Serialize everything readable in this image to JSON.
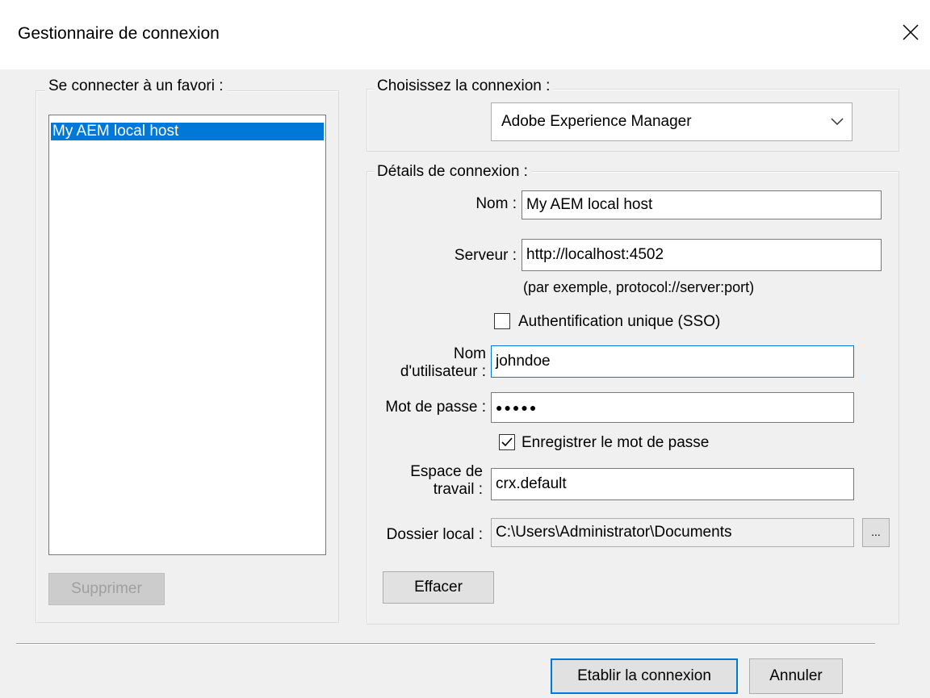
{
  "window": {
    "title": "Gestionnaire de connexion"
  },
  "favorites": {
    "group_label": "Se connecter à un favori :",
    "items": [
      "My AEM local host"
    ],
    "delete_button": "Supprimer"
  },
  "connection": {
    "group_label": "Choisissez la connexion :",
    "selected": "Adobe Experience Manager"
  },
  "details": {
    "group_label": "Détails de connexion :",
    "name_label": "Nom :",
    "name_value": "My AEM local host",
    "server_label": "Serveur :",
    "server_value": "http://localhost:4502",
    "server_hint": "(par exemple, protocol://server:port)",
    "sso_label": "Authentification unique (SSO)",
    "sso_checked": false,
    "username_label_line1": "Nom",
    "username_label_line2": "d'utilisateur :",
    "username_value": "johndoe",
    "password_label": "Mot de passe :",
    "password_value": "●●●●●",
    "save_password_label": "Enregistrer le mot de passe",
    "save_password_checked": true,
    "workspace_label_line1": "Espace de",
    "workspace_label_line2": "travail :",
    "workspace_value": "crx.default",
    "local_folder_label": "Dossier local :",
    "local_folder_value": "C:\\Users\\Administrator\\Documents",
    "browse_button": "...",
    "clear_button": "Effacer"
  },
  "footer": {
    "connect_button": "Etablir la connexion",
    "cancel_button": "Annuler"
  }
}
